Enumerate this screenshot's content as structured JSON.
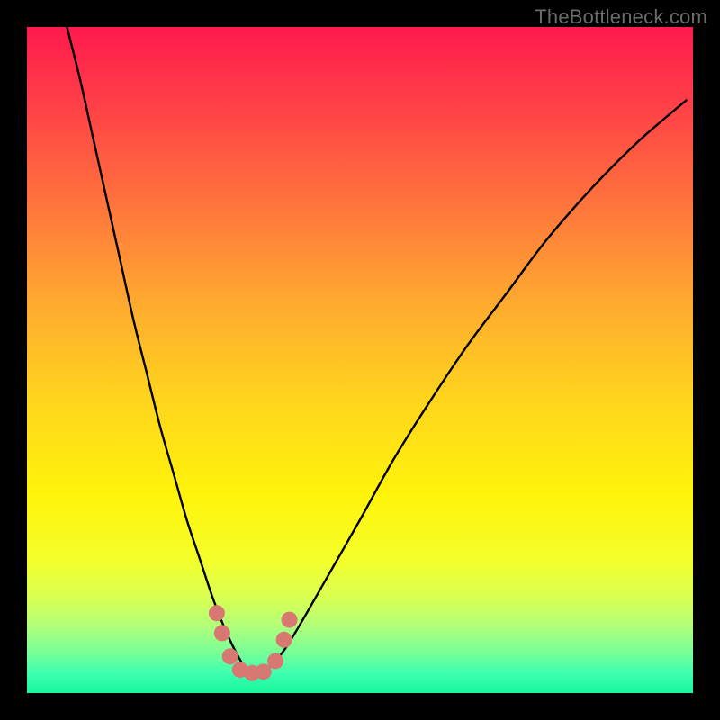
{
  "watermark": "TheBottleneck.com",
  "chart_data": {
    "type": "line",
    "title": "",
    "xlabel": "",
    "ylabel": "",
    "xlim": [
      0,
      100
    ],
    "ylim": [
      0,
      100
    ],
    "note": "No axis ticks or numeric labels are rendered. Values are pixel-normalized 0-100; y=0 is the bottom (green) and y=100 is the top (red). Curve shape inferred from image.",
    "gradient_stops": [
      {
        "offset": 0.0,
        "color": "#ff1a4d"
      },
      {
        "offset": 0.1,
        "color": "#ff3a48"
      },
      {
        "offset": 0.25,
        "color": "#ff6e3e"
      },
      {
        "offset": 0.4,
        "color": "#ffa531"
      },
      {
        "offset": 0.55,
        "color": "#ffd21e"
      },
      {
        "offset": 0.7,
        "color": "#fff30a"
      },
      {
        "offset": 0.8,
        "color": "#f4ff2a"
      },
      {
        "offset": 0.86,
        "color": "#d7ff55"
      },
      {
        "offset": 0.9,
        "color": "#b0ff7a"
      },
      {
        "offset": 0.94,
        "color": "#77ff98"
      },
      {
        "offset": 0.97,
        "color": "#3effb0"
      },
      {
        "offset": 1.0,
        "color": "#17f79c"
      }
    ],
    "series": [
      {
        "name": "bottleneck-curve",
        "x": [
          6,
          8,
          10,
          12,
          14,
          16,
          18,
          20,
          22,
          24,
          26,
          28,
          30,
          32,
          33.5,
          35,
          37,
          39,
          42,
          46,
          50,
          55,
          60,
          66,
          72,
          78,
          85,
          92,
          99
        ],
        "y": [
          100,
          92,
          83,
          74,
          65,
          56,
          48,
          40,
          33,
          26,
          20,
          14,
          9,
          5,
          3,
          3,
          4.5,
          7,
          12,
          19,
          26,
          35,
          43,
          52,
          60,
          68,
          76,
          83,
          89
        ]
      }
    ],
    "markers": {
      "name": "highlight-points",
      "color": "#d77872",
      "radius_px": 9,
      "points": [
        {
          "x": 28.5,
          "y": 12
        },
        {
          "x": 29.3,
          "y": 9
        },
        {
          "x": 30.5,
          "y": 5.5
        },
        {
          "x": 32.0,
          "y": 3.5
        },
        {
          "x": 33.8,
          "y": 3.0
        },
        {
          "x": 35.5,
          "y": 3.2
        },
        {
          "x": 37.3,
          "y": 4.8
        },
        {
          "x": 38.6,
          "y": 8.0
        },
        {
          "x": 39.4,
          "y": 11.0
        }
      ]
    }
  }
}
